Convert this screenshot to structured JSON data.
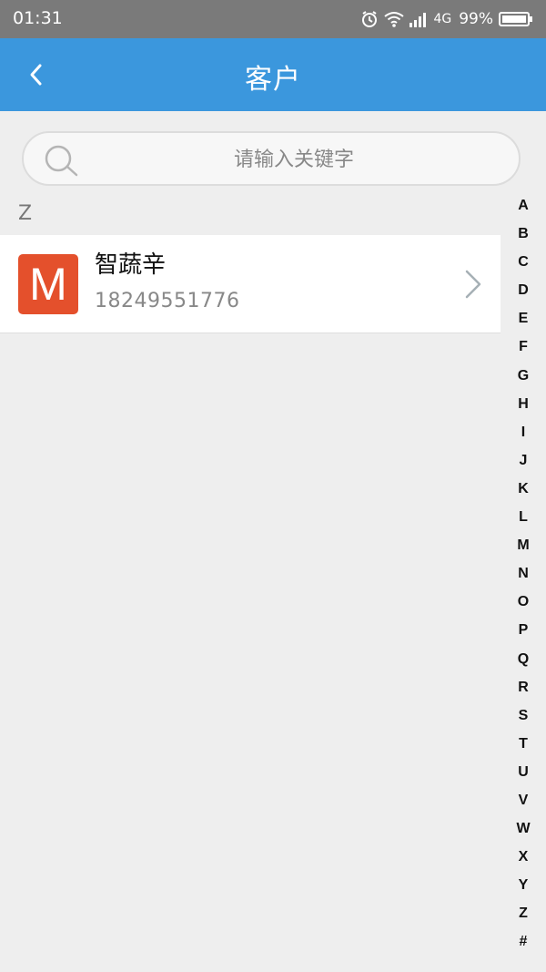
{
  "status_bar": {
    "time": "01:31",
    "network": "4G",
    "battery": "99%"
  },
  "header": {
    "title": "客户",
    "back_icon": "chevron-left-icon"
  },
  "search": {
    "placeholder": "请输入关键字",
    "icon": "search-icon"
  },
  "section": {
    "letter": "Z"
  },
  "contacts": [
    {
      "avatar_letter": "M",
      "avatar_color": "#e4502c",
      "name": "智蔬辛",
      "phone": "18249551776"
    }
  ],
  "index_letters": [
    "A",
    "B",
    "C",
    "D",
    "E",
    "F",
    "G",
    "H",
    "I",
    "J",
    "K",
    "L",
    "M",
    "N",
    "O",
    "P",
    "Q",
    "R",
    "S",
    "T",
    "U",
    "V",
    "W",
    "X",
    "Y",
    "Z",
    "#"
  ],
  "colors": {
    "accent": "#3b97dd",
    "status_bar": "#7a7a7a",
    "background": "#eeeeee"
  }
}
